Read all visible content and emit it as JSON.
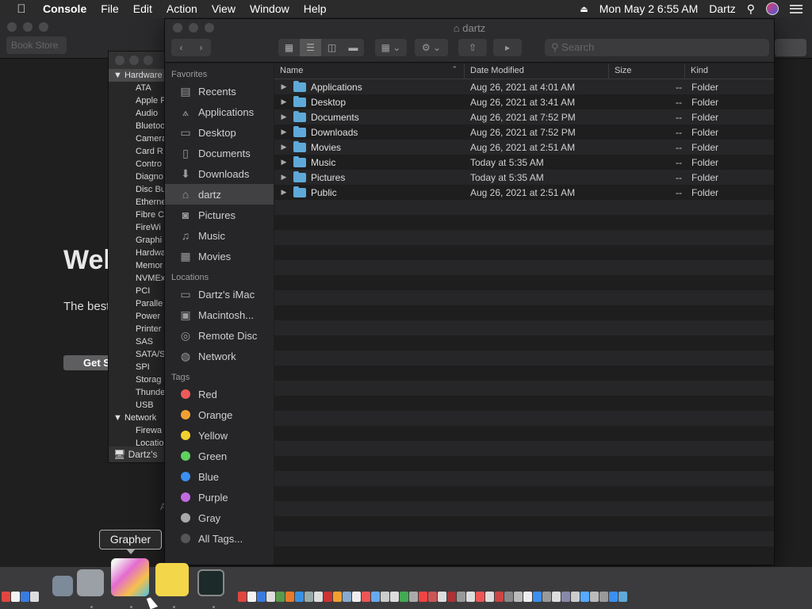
{
  "menubar": {
    "apple_icon": "apple-logo-icon",
    "app_name": "Console",
    "menus": [
      "File",
      "Edit",
      "Action",
      "View",
      "Window",
      "Help"
    ],
    "datetime": "Mon May 2  6:55 AM",
    "user": "Dartz"
  },
  "appstore_bg": {
    "search_placeholder": "Book Store",
    "welcome": "Wel",
    "tagline": "The best",
    "button": "Get S",
    "footer_letter": "A"
  },
  "sysinfo": {
    "sections": [
      {
        "label": "Hardware",
        "items": [
          "ATA",
          "Apple P",
          "Audio",
          "Bluetoo",
          "Camera",
          "Card R",
          "Contro",
          "Diagno",
          "Disc Bu",
          "Etherne",
          "Fibre C",
          "FireWi",
          "Graphi",
          "Hardwa",
          "Memor",
          "NVMEx",
          "PCI",
          "Paralle",
          "Power",
          "Printer",
          "SAS",
          "SATA/S",
          "SPI",
          "Storag",
          "Thunde",
          "USB"
        ]
      },
      {
        "label": "Network",
        "items": [
          "Firewa",
          "Locatio"
        ]
      }
    ],
    "footer": "Dartz's"
  },
  "finder": {
    "title": "dartz",
    "search_placeholder": "Search",
    "sidebar": {
      "favorites_header": "Favorites",
      "favorites": [
        {
          "label": "Recents",
          "icon": "recents-icon",
          "glyph": "▤"
        },
        {
          "label": "Applications",
          "icon": "applications-icon",
          "glyph": "⟑"
        },
        {
          "label": "Desktop",
          "icon": "desktop-icon",
          "glyph": "▭"
        },
        {
          "label": "Documents",
          "icon": "documents-icon",
          "glyph": "▯"
        },
        {
          "label": "Downloads",
          "icon": "downloads-icon",
          "glyph": "⬇"
        },
        {
          "label": "dartz",
          "icon": "home-icon",
          "glyph": "⌂"
        },
        {
          "label": "Pictures",
          "icon": "pictures-icon",
          "glyph": "◙"
        },
        {
          "label": "Music",
          "icon": "music-icon",
          "glyph": "♫"
        },
        {
          "label": "Movies",
          "icon": "movies-icon",
          "glyph": "▦"
        }
      ],
      "locations_header": "Locations",
      "locations": [
        {
          "label": "Dartz's iMac",
          "icon": "imac-icon",
          "glyph": "▭"
        },
        {
          "label": "Macintosh...",
          "icon": "hard-disk-icon",
          "glyph": "▣"
        },
        {
          "label": "Remote Disc",
          "icon": "disc-icon",
          "glyph": "◎"
        },
        {
          "label": "Network",
          "icon": "network-icon",
          "glyph": "◍"
        }
      ],
      "tags_header": "Tags",
      "tags": [
        {
          "label": "Red",
          "color": "#ec5b5b"
        },
        {
          "label": "Orange",
          "color": "#f0a033"
        },
        {
          "label": "Yellow",
          "color": "#f2d12f"
        },
        {
          "label": "Green",
          "color": "#5fd15f"
        },
        {
          "label": "Blue",
          "color": "#3b8ff0"
        },
        {
          "label": "Purple",
          "color": "#c16ae0"
        },
        {
          "label": "Gray",
          "color": "#a9a9a9"
        },
        {
          "label": "All Tags...",
          "color": "#555555"
        }
      ]
    },
    "columns": {
      "name": "Name",
      "date": "Date Modified",
      "size": "Size",
      "kind": "Kind"
    },
    "files": [
      {
        "name": "Applications",
        "date": "Aug 26, 2021 at 4:01 AM",
        "size": "--",
        "kind": "Folder"
      },
      {
        "name": "Desktop",
        "date": "Aug 26, 2021 at 3:41 AM",
        "size": "--",
        "kind": "Folder"
      },
      {
        "name": "Documents",
        "date": "Aug 26, 2021 at 7:52 PM",
        "size": "--",
        "kind": "Folder"
      },
      {
        "name": "Downloads",
        "date": "Aug 26, 2021 at 7:52 PM",
        "size": "--",
        "kind": "Folder"
      },
      {
        "name": "Movies",
        "date": "Aug 26, 2021 at 2:51 AM",
        "size": "--",
        "kind": "Folder"
      },
      {
        "name": "Music",
        "date": "Today at 5:35 AM",
        "size": "--",
        "kind": "Folder"
      },
      {
        "name": "Pictures",
        "date": "Today at 5:35 AM",
        "size": "--",
        "kind": "Folder"
      },
      {
        "name": "Public",
        "date": "Aug 26, 2021 at 2:51 AM",
        "size": "--",
        "kind": "Folder"
      }
    ]
  },
  "tooltip": "Grapher",
  "dock": {
    "big_apps": [
      {
        "name": "utilities-icon",
        "color": "#7c8a99"
      },
      {
        "name": "accessibility-icon",
        "color": "#9aa0a6"
      },
      {
        "name": "grapher-icon",
        "color": "#d66ad0"
      },
      {
        "name": "stickies-icon",
        "color": "#f3d64a"
      },
      {
        "name": "activity-monitor-icon",
        "color": "#1c2a2a"
      }
    ]
  }
}
